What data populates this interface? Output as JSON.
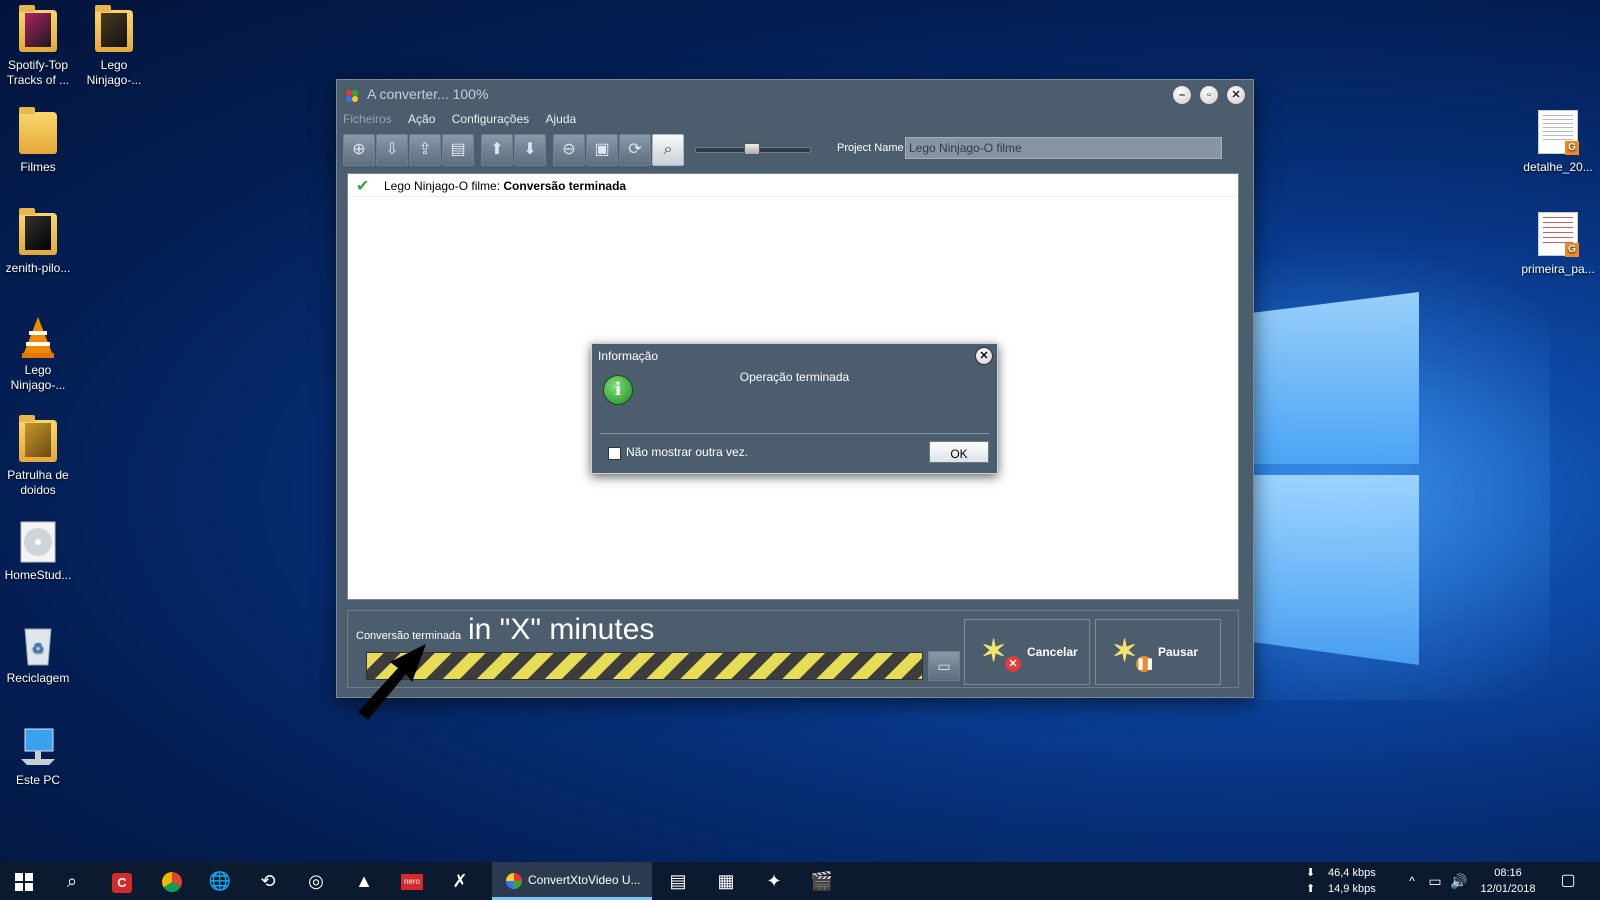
{
  "desktop": {
    "icons_left": [
      {
        "label": "Spotify-Top Tracks of ..."
      },
      {
        "label": "Lego Ninjago-..."
      },
      {
        "label": "Filmes"
      },
      {
        "label": "zenith-pilo..."
      },
      {
        "label": "Lego Ninjago-..."
      },
      {
        "label": "Patrulha de doidos"
      },
      {
        "label": "HomeStud..."
      },
      {
        "label": "Reciclagem"
      },
      {
        "label": "Este PC"
      }
    ],
    "icons_right": [
      {
        "label": "detalhe_20..."
      },
      {
        "label": "primeira_pa..."
      }
    ]
  },
  "window": {
    "title": "A converter... 100%",
    "menu": [
      "Ficheiros",
      "Ação",
      "Configurações",
      "Ajuda"
    ],
    "project_name_label": "Project Name",
    "project_name_value": "Lego Ninjago-O filme",
    "list": [
      {
        "name": "Lego Ninjago-O filme: ",
        "status": "Conversão terminada"
      }
    ],
    "status_text": "Conversão terminada",
    "annotation": "in \"X\" minutes",
    "progress": 1.0,
    "cancel_label": "Cancelar",
    "pause_label": "Pausar"
  },
  "dialog": {
    "title": "Informação",
    "message": "Operação terminada",
    "checkbox_label": "Não mostrar outra vez.",
    "ok_label": "OK"
  },
  "taskbar": {
    "active_task": "ConvertXtoVideo U...",
    "download_speed": "46,4 kbps",
    "upload_speed": "14,9 kbps",
    "time": "08:16",
    "date": "12/01/2018"
  },
  "colors": {
    "window_bg": "#4c5d6e",
    "progress_stripe_yellow": "#e6dc55",
    "taskbar_bg": "#0b1a2e"
  }
}
